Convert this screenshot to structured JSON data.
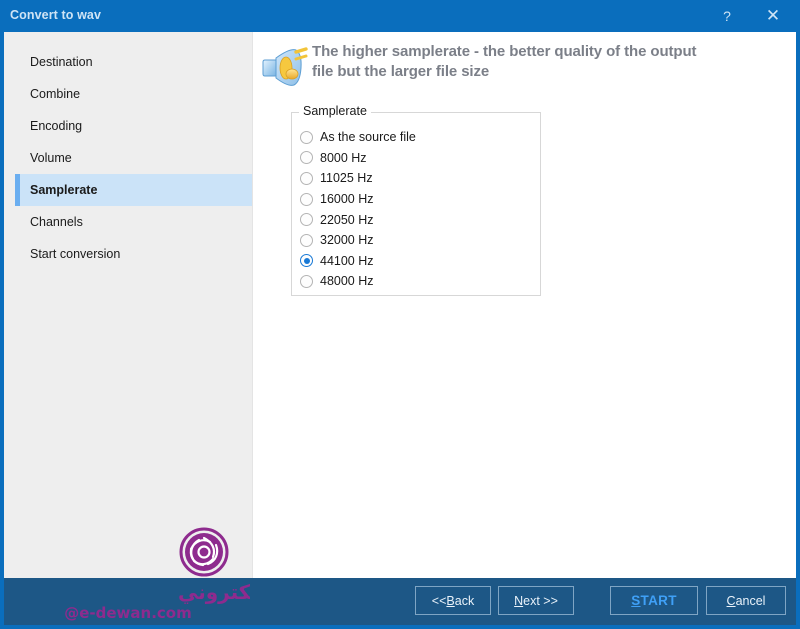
{
  "window": {
    "title": "Convert to wav",
    "help_label": "?",
    "close_label": "✕"
  },
  "sidebar": {
    "items": [
      {
        "label": "Destination",
        "active": false
      },
      {
        "label": "Combine",
        "active": false
      },
      {
        "label": "Encoding",
        "active": false
      },
      {
        "label": "Volume",
        "active": false
      },
      {
        "label": "Samplerate",
        "active": true
      },
      {
        "label": "Channels",
        "active": false
      },
      {
        "label": "Start conversion",
        "active": false
      }
    ]
  },
  "header": {
    "icon": "speaker-music-note-icon",
    "line1": "The higher samplerate - the better quality of the output",
    "line2": "file but the larger file size"
  },
  "samplerate_group": {
    "legend": "Samplerate",
    "options": [
      {
        "label": "As the source file",
        "selected": false
      },
      {
        "label": "8000 Hz",
        "selected": false
      },
      {
        "label": "11025 Hz",
        "selected": false
      },
      {
        "label": "16000 Hz",
        "selected": false
      },
      {
        "label": "22050 Hz",
        "selected": false
      },
      {
        "label": "32000 Hz",
        "selected": false
      },
      {
        "label": "44100 Hz",
        "selected": true
      },
      {
        "label": "48000 Hz",
        "selected": false
      }
    ],
    "selected_value": "44100 Hz"
  },
  "watermark": {
    "arabic_text": "الـديـوان الإلكتروني",
    "site": "@e-dewan.com",
    "logo": "spiral-circle-logo",
    "color": "#8e2b8e"
  },
  "footer": {
    "back": {
      "pre": "<< ",
      "accel": "B",
      "post": "ack"
    },
    "next": {
      "pre": "",
      "accel": "N",
      "post": "ext >>"
    },
    "start": {
      "pre": "",
      "accel": "S",
      "post": "TART"
    },
    "cancel": {
      "pre": "",
      "accel": "C",
      "post": "ancel"
    }
  },
  "colors": {
    "titlebar": "#0a6ebd",
    "footer": "#1d5786",
    "sidebar": "#eeeeee",
    "accent_selected": "#6aaef0",
    "highlight": "#cbe3f8",
    "radio_selected": "#1879d6",
    "start_text": "#3fa0f7"
  }
}
